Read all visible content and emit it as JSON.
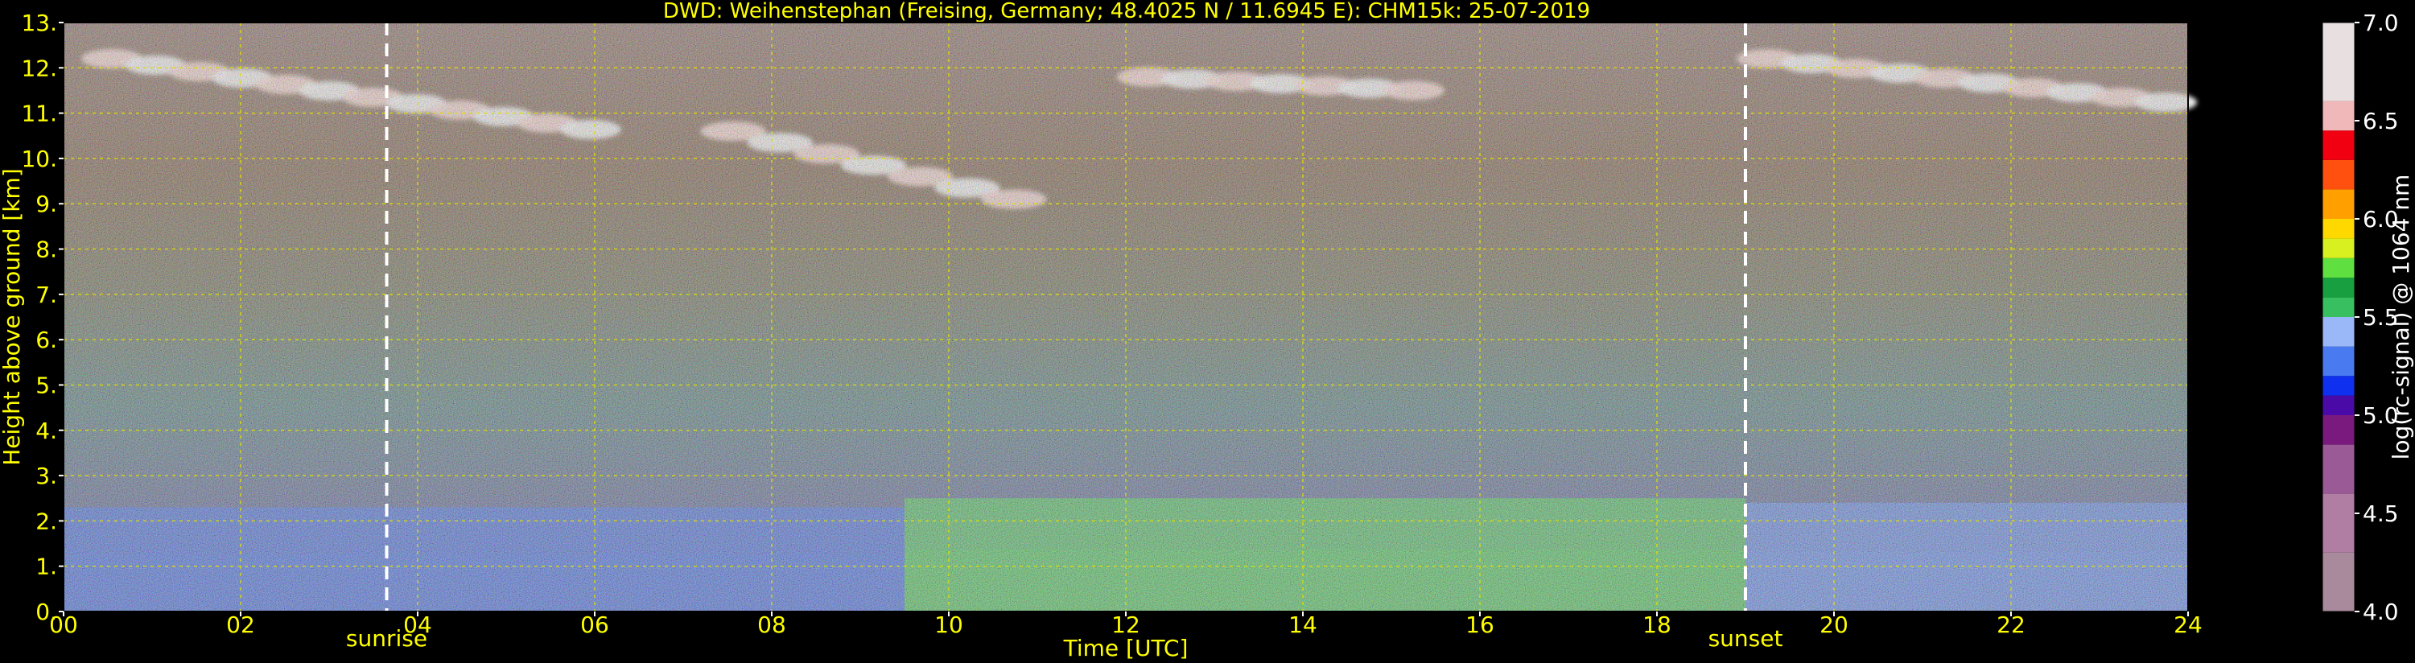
{
  "chart_data": {
    "type": "heatmap",
    "title": "DWD: Weihenstephan (Freising, Germany; 48.4025 N / 11.6945 E):    CHM15k: 25-07-2019",
    "xlabel": "Time [UTC]",
    "ylabel": "Height above ground [km]",
    "colorbar_label": "log(rc-signal) @ 1064 nm",
    "xlim": [
      0,
      24
    ],
    "ylim": [
      0,
      13
    ],
    "clim": [
      4.0,
      7.0
    ],
    "grid": true,
    "x_ticks": [
      "00",
      "02",
      "04",
      "06",
      "08",
      "10",
      "12",
      "14",
      "16",
      "18",
      "20",
      "22",
      "24"
    ],
    "y_ticks": [
      "0.",
      "1.",
      "2.",
      "3.",
      "4.",
      "5.",
      "6.",
      "7.",
      "8.",
      "9.",
      "10.",
      "11.",
      "12.",
      "13."
    ],
    "colorbar_ticks": [
      "4.0",
      "4.5",
      "5.0",
      "5.5",
      "6.0",
      "6.5",
      "7.0"
    ],
    "annotations": [
      {
        "label": "sunrise",
        "time": 3.65
      },
      {
        "label": "sunset",
        "time": 19.0
      }
    ],
    "colormap": [
      {
        "value": 4.0,
        "color": "#a88a9c"
      },
      {
        "value": 4.3,
        "color": "#b07ea2"
      },
      {
        "value": 4.6,
        "color": "#9a5a96"
      },
      {
        "value": 4.85,
        "color": "#7a1a7e"
      },
      {
        "value": 5.0,
        "color": "#4a0aa8"
      },
      {
        "value": 5.1,
        "color": "#1030f0"
      },
      {
        "value": 5.2,
        "color": "#4a7af0"
      },
      {
        "value": 5.35,
        "color": "#9ab8f8"
      },
      {
        "value": 5.5,
        "color": "#38c060"
      },
      {
        "value": 5.6,
        "color": "#18a040"
      },
      {
        "value": 5.7,
        "color": "#60e040"
      },
      {
        "value": 5.8,
        "color": "#d8f020"
      },
      {
        "value": 5.9,
        "color": "#ffd800"
      },
      {
        "value": 6.0,
        "color": "#ffa000"
      },
      {
        "value": 6.15,
        "color": "#ff5010"
      },
      {
        "value": 6.3,
        "color": "#f00010"
      },
      {
        "value": 6.45,
        "color": "#f0b8b8"
      },
      {
        "value": 6.6,
        "color": "#e8e0e0"
      },
      {
        "value": 7.0,
        "color": "#ffffff"
      }
    ],
    "features": [
      {
        "name": "boundary layer (night, blue)",
        "t_start": 0,
        "t_end": 9.5,
        "h_top": 2.3
      },
      {
        "name": "boundary layer (day, green)",
        "t_start": 9.5,
        "t_end": 19.0,
        "h_top": 2.5
      },
      {
        "name": "boundary layer (evening, blue)",
        "t_start": 19.0,
        "t_end": 24,
        "h_top": 2.4
      },
      {
        "name": "cirrus layer (morning)",
        "t_start": 0.3,
        "t_end": 6.2,
        "h_bottom": 9.8,
        "h_top": 12.4
      },
      {
        "name": "cirrus fragments",
        "t_start": 7.3,
        "t_end": 11.0,
        "h_bottom": 8.3,
        "h_top": 10.8
      },
      {
        "name": "cirrus layer (midday)",
        "t_start": 12.0,
        "t_end": 15.5,
        "h_bottom": 11.5,
        "h_top": 12.0
      },
      {
        "name": "cirrus layer (evening)",
        "t_start": 19.0,
        "t_end": 24,
        "h_bottom": 10.8,
        "h_top": 12.4
      }
    ]
  }
}
